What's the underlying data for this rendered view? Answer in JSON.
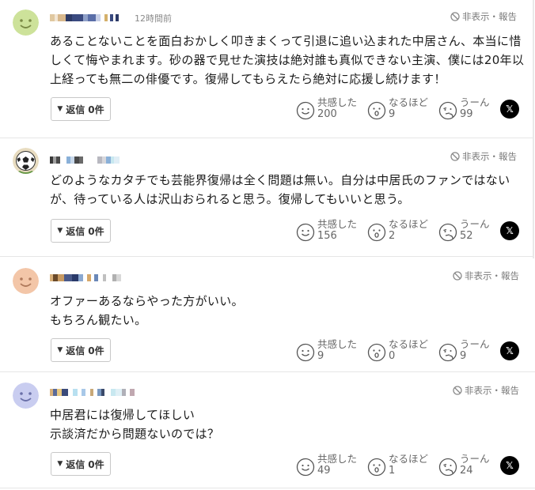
{
  "labels": {
    "hide_report": "非表示・報告",
    "reply_prefix": "返信",
    "react_kyokan": "共感した",
    "react_naruhodo": "なるほど",
    "react_uun": "うーん",
    "x_share": "𝕏"
  },
  "comments": [
    {
      "avatar": "yellow-face",
      "timestamp": "12時間前",
      "lines": [
        "あることないことを面白おかしく叩きまくって引退に追い込まれた中居さん、本当に惜",
        "しくて悔やまれます。砂の器で見せた演技は絶対誰も真似できない主演、僕には20年以",
        "上経っても無二の俳優です。復帰してもらえたら絶対に応援し続けます！"
      ],
      "reply_count": "0件",
      "kyokan": "200",
      "naruhodo": "9",
      "uun": "99"
    },
    {
      "avatar": "soccer-ball",
      "timestamp": "",
      "lines": [
        "どのようなカタチでも芸能界復帰は全く問題は無い。自分は中居氏のファンではない",
        "が、待っている人は沢山おられると思う。復帰してもいいと思う。"
      ],
      "reply_count": "0件",
      "kyokan": "156",
      "naruhodo": "2",
      "uun": "52"
    },
    {
      "avatar": "orange-face",
      "timestamp": "",
      "lines": [
        "オファーあるならやった方がいい。",
        "もちろん観たい。"
      ],
      "reply_count": "0件",
      "kyokan": "9",
      "naruhodo": "0",
      "uun": "9"
    },
    {
      "avatar": "blue-face",
      "timestamp": "",
      "lines": [
        "中居君には復帰してほしい",
        "示談済だから問題ないのでは？"
      ],
      "reply_count": "0件",
      "kyokan": "49",
      "naruhodo": "1",
      "uun": "24"
    }
  ]
}
